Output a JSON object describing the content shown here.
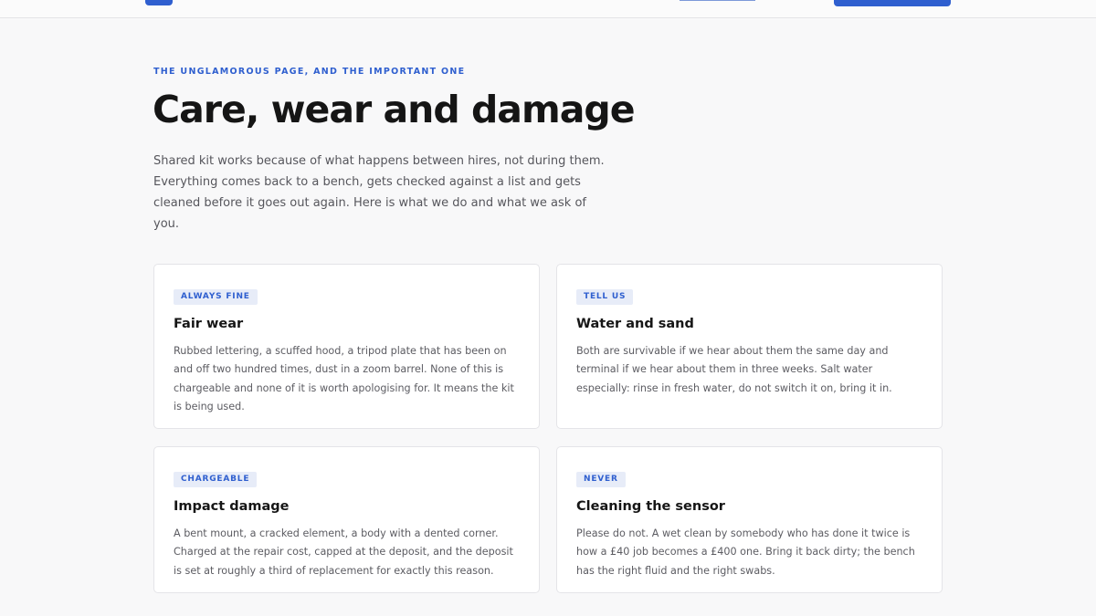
{
  "hero": {
    "eyebrow": "THE UNGLAMOROUS PAGE, AND THE IMPORTANT ONE",
    "title": "Care, wear and damage",
    "intro": "Shared kit works because of what happens between hires, not during them. Everything comes back to a bench, gets checked against a list and gets cleaned before it goes out again. Here is what we do and what we ask of you."
  },
  "cards": [
    {
      "badge": "ALWAYS FINE",
      "title": "Fair wear",
      "body": "Rubbed lettering, a scuffed hood, a tripod plate that has been on and off two hundred times, dust in a zoom barrel. None of this is chargeable and none of it is worth apologising for. It means the kit is being used."
    },
    {
      "badge": "TELL US",
      "title": "Water and sand",
      "body": "Both are survivable if we hear about them the same day and terminal if we hear about them in three weeks. Salt water especially: rinse in fresh water, do not switch it on, bring it in."
    },
    {
      "badge": "CHARGEABLE",
      "title": "Impact damage",
      "body": "A bent mount, a cracked element, a body with a dented corner. Charged at the repair cost, capped at the deposit, and the deposit is set at roughly a third of replacement for exactly this reason."
    },
    {
      "badge": "NEVER",
      "title": "Cleaning the sensor",
      "body": "Please do not. A wet clean by somebody who has done it twice is how a £40 job becomes a £400 one. Bring it back dirty; the bench has the right fluid and the right swabs."
    }
  ],
  "colors": {
    "accent": "#2f5fcf",
    "badge_bg": "#e7ecf8",
    "page_bg": "#f8f8f9"
  }
}
